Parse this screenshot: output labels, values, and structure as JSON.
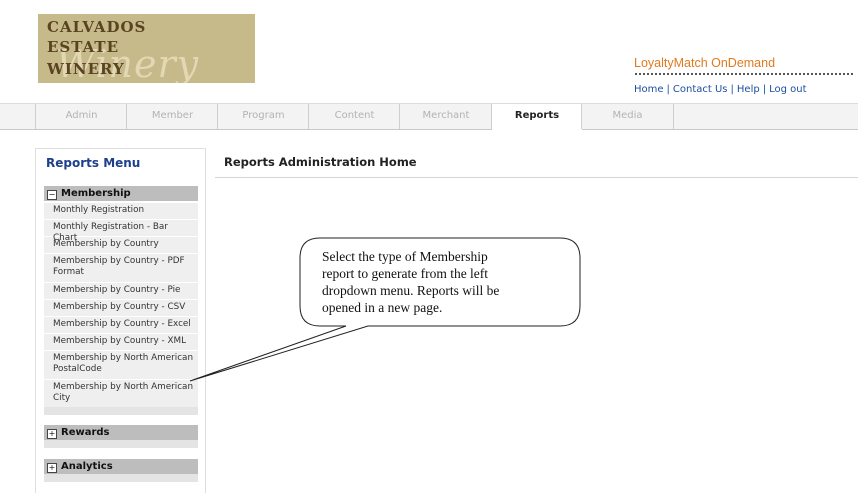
{
  "logo": {
    "line1": "CALVADOS",
    "line2": "ESTATE",
    "line3": "WINERY",
    "script": "Winery"
  },
  "brand": "LoyaltyMatch OnDemand",
  "toplinks": {
    "home": "Home",
    "contact": "Contact Us",
    "help": "Help",
    "logout": "Log out",
    "separator": "|"
  },
  "tabs": [
    {
      "label": "Admin"
    },
    {
      "label": "Member"
    },
    {
      "label": "Program"
    },
    {
      "label": "Content"
    },
    {
      "label": "Merchant"
    },
    {
      "label": "Reports",
      "active": true
    },
    {
      "label": "Media"
    }
  ],
  "sidebar": {
    "title": "Reports Menu",
    "membership": {
      "label": "Membership",
      "toggle": "−",
      "items": [
        "Monthly Registration",
        "Monthly Registration - Bar Chart",
        "Membership by Country",
        "Membership by Country - PDF Format",
        "Membership by Country - Pie",
        "Membership by Country - CSV",
        "Membership by Country - Excel",
        "Membership by Country - XML",
        "Membership by North American PostalCode",
        "Membership by North American City"
      ]
    },
    "rewards": {
      "label": "Rewards",
      "toggle": "+"
    },
    "analytics": {
      "label": "Analytics",
      "toggle": "+"
    }
  },
  "main": {
    "title": "Reports Administration Home"
  },
  "callout": {
    "line1": "Select the type of Membership",
    "line2": "report to generate from the left",
    "line3": "dropdown menu. Reports will be",
    "line4": "opened in a new page."
  },
  "colors": {
    "brand_orange": "#e07a1f",
    "link_blue": "#1d4fa0",
    "menu_title_blue": "#1d3f8c",
    "logo_bg": "#c6b98a"
  }
}
